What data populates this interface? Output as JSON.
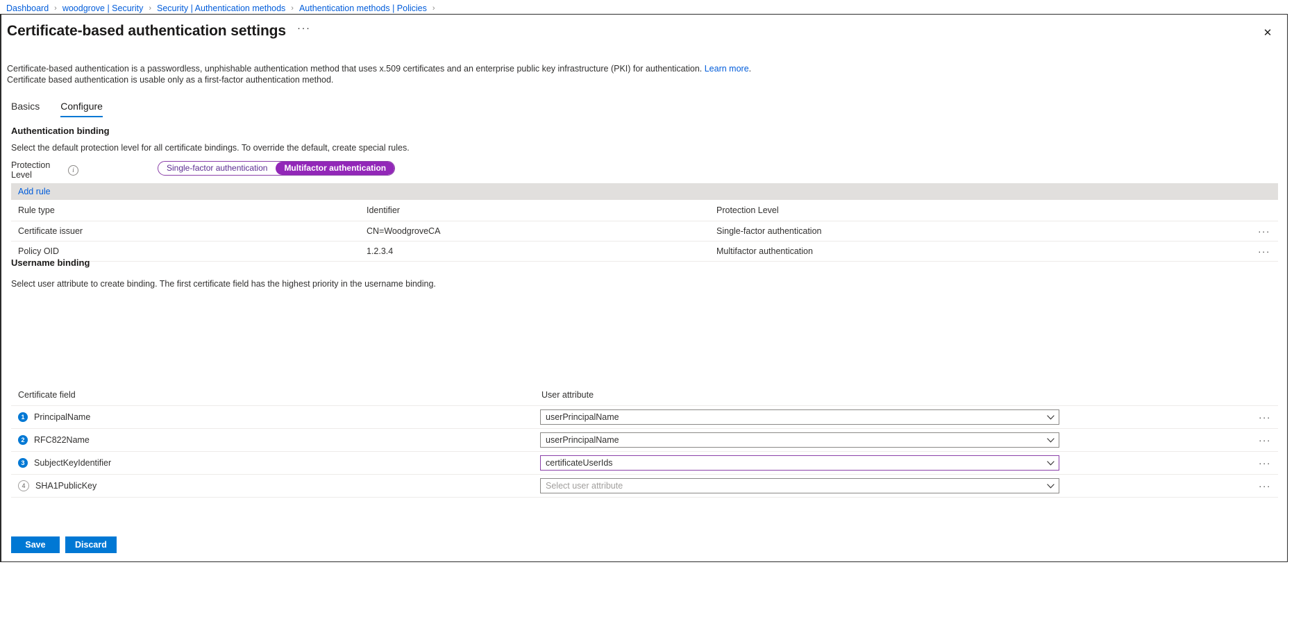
{
  "breadcrumb": {
    "items": [
      {
        "label": "Dashboard"
      },
      {
        "label": "woodgrove | Security"
      },
      {
        "label": "Security | Authentication methods"
      },
      {
        "label": "Authentication methods | Policies"
      }
    ],
    "separator": "›"
  },
  "header": {
    "title": "Certificate-based authentication settings",
    "ellipsis": "···",
    "close_label": "✕"
  },
  "description": {
    "line1_pre": "Certificate-based authentication is a passwordless, unphishable authentication method that uses x.509 certificates and an enterprise public key infrastructure (PKI) for authentication. ",
    "line1_link": "Learn more",
    "line1_post": ".",
    "line2": "Certificate based authentication is usable only as a first-factor authentication method."
  },
  "tabs": [
    {
      "label": "Basics",
      "active": false
    },
    {
      "label": "Configure",
      "active": true
    }
  ],
  "auth_binding": {
    "heading": "Authentication binding",
    "subtext": "Select the default protection level for all certificate bindings. To override the default, create special rules.",
    "protection_label": "Protection Level",
    "info_glyph": "i",
    "toggle": {
      "options": [
        "Single-factor authentication",
        "Multifactor authentication"
      ],
      "selected": "Multifactor authentication",
      "accent_color": "#9227b8"
    },
    "add_rule_label": "Add rule",
    "table": {
      "columns": [
        "Rule type",
        "Identifier",
        "Protection Level"
      ],
      "rows": [
        {
          "rule_type": "Certificate issuer",
          "identifier": "CN=WoodgroveCA",
          "protection_level": "Single-factor authentication",
          "more": "···"
        },
        {
          "rule_type": "Policy OID",
          "identifier": "1.2.3.4",
          "protection_level": "Multifactor authentication",
          "more": "···"
        }
      ]
    }
  },
  "username_binding": {
    "heading": "Username binding",
    "subtext": "Select user attribute to create binding. The first certificate field has the highest priority in the username binding.",
    "columns": [
      "Certificate field",
      "User attribute"
    ],
    "rows": [
      {
        "order": "1",
        "order_filled": true,
        "certificate_field": "PrincipalName",
        "user_attribute": "userPrincipalName",
        "is_placeholder": false,
        "focused": false,
        "more": "···"
      },
      {
        "order": "2",
        "order_filled": true,
        "certificate_field": "RFC822Name",
        "user_attribute": "userPrincipalName",
        "is_placeholder": false,
        "focused": false,
        "more": "···"
      },
      {
        "order": "3",
        "order_filled": true,
        "certificate_field": "SubjectKeyIdentifier",
        "user_attribute": "certificateUserIds",
        "is_placeholder": false,
        "focused": true,
        "more": "···"
      },
      {
        "order": "4",
        "order_filled": false,
        "certificate_field": "SHA1PublicKey",
        "user_attribute": "Select user attribute",
        "is_placeholder": true,
        "focused": false,
        "more": "···"
      }
    ]
  },
  "footer": {
    "save_label": "Save",
    "discard_label": "Discard"
  },
  "colors": {
    "link": "#015cda",
    "primary": "#0078d4",
    "purple": "#9227b8",
    "toolbar_bg": "#e1dfdd"
  }
}
